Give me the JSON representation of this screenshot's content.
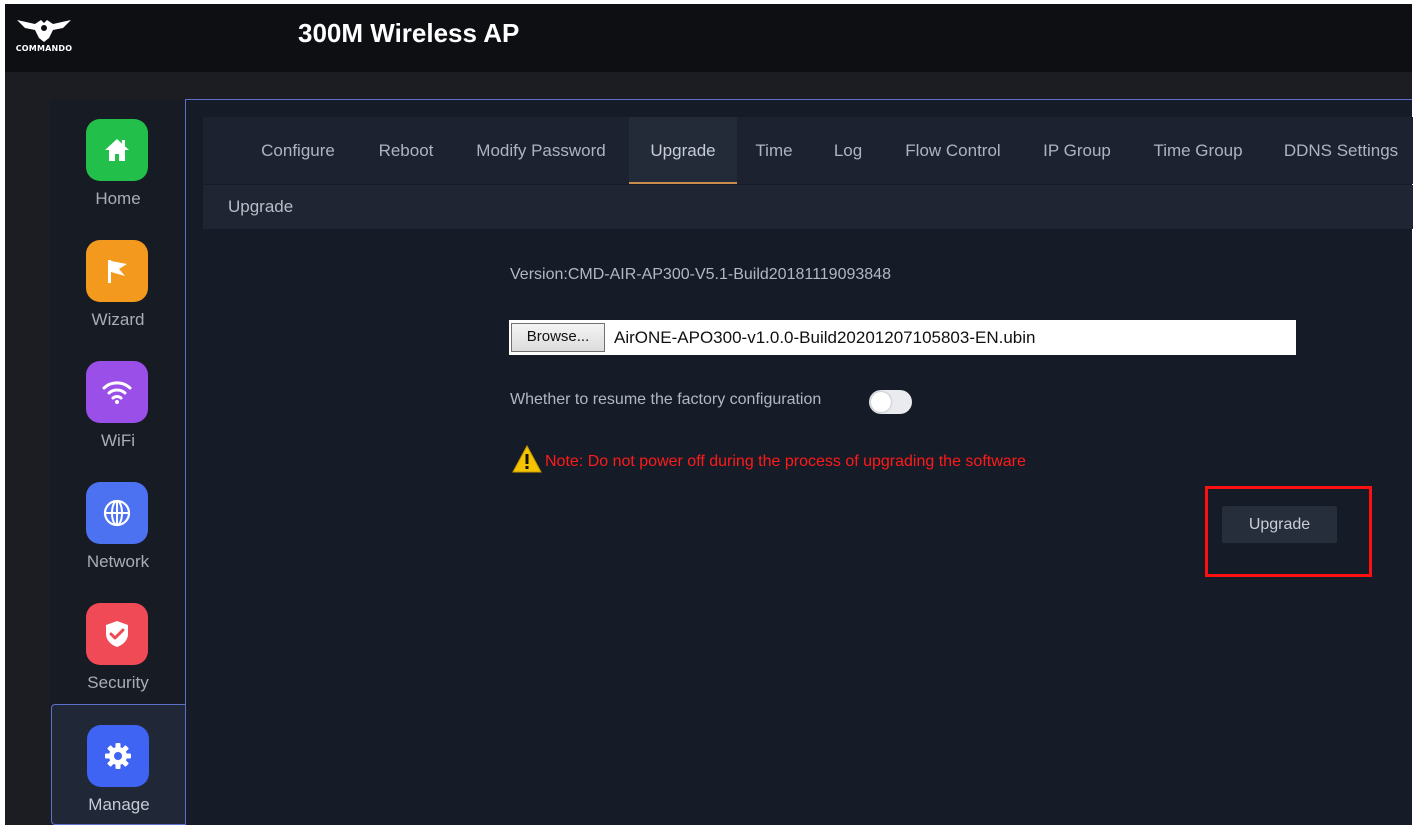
{
  "header": {
    "logo_text": "COMMANDO",
    "title": "300M Wireless AP"
  },
  "sidebar": {
    "items": [
      {
        "label": "Home",
        "icon": "home-icon",
        "color": "#22c04a"
      },
      {
        "label": "Wizard",
        "icon": "flag-icon",
        "color": "#f39a1e"
      },
      {
        "label": "WiFi",
        "icon": "wifi-icon",
        "color": "#9a4fe8"
      },
      {
        "label": "Network",
        "icon": "globe-icon",
        "color": "#4c72f2"
      },
      {
        "label": "Security",
        "icon": "shield-icon",
        "color": "#ef4a56"
      },
      {
        "label": "Manage",
        "icon": "gear-icon",
        "color": "#3f63f3",
        "active": true
      }
    ]
  },
  "tabs": {
    "items": [
      {
        "label": "Configure"
      },
      {
        "label": "Reboot"
      },
      {
        "label": "Modify Password"
      },
      {
        "label": "Upgrade",
        "active": true
      },
      {
        "label": "Time"
      },
      {
        "label": "Log"
      },
      {
        "label": "Flow Control"
      },
      {
        "label": "IP Group"
      },
      {
        "label": "Time Group"
      },
      {
        "label": "DDNS Settings"
      }
    ]
  },
  "section": {
    "title": "Upgrade"
  },
  "upgrade": {
    "version": "Version:CMD-AIR-AP300-V5.1-Build20181119093848",
    "browse_label": "Browse...",
    "file_name": "AirONE-APO300-v1.0.0-Build20201207105803-EN.ubin",
    "factory_label": "Whether to resume the factory configuration",
    "factory_enabled": false,
    "warning": "Note: Do not power off during the process of upgrading the software",
    "warning_color": "#ff1a1a",
    "button_label": "Upgrade"
  },
  "colors": {
    "accent_border": "#5f6ec9",
    "tab_active_underline": "#c98b4e",
    "highlight_box": "#ff1010"
  }
}
